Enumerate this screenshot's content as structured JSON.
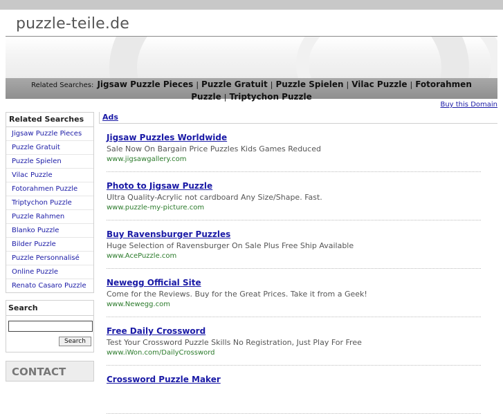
{
  "site": {
    "domain_title": "puzzle-teile.de",
    "buy_domain": "Buy this Domain"
  },
  "related_bar": {
    "label": "Related Searches:",
    "links": [
      "Jigsaw Puzzle Pieces",
      "Puzzle Gratuit",
      "Puzzle Spielen",
      "Vilac Puzzle",
      "Fotorahmen Puzzle",
      "Triptychon Puzzle"
    ],
    "separator": "|"
  },
  "sidebar": {
    "heading": "Related Searches",
    "items": [
      {
        "label": "Jigsaw Puzzle Pieces"
      },
      {
        "label": "Puzzle Gratuit"
      },
      {
        "label": "Puzzle Spielen"
      },
      {
        "label": "Vilac Puzzle"
      },
      {
        "label": "Fotorahmen Puzzle"
      },
      {
        "label": "Triptychon Puzzle"
      },
      {
        "label": "Puzzle Rahmen"
      },
      {
        "label": "Blanko Puzzle"
      },
      {
        "label": "Bilder Puzzle"
      },
      {
        "label": "Puzzle Personnalisé"
      },
      {
        "label": "Online Puzzle"
      },
      {
        "label": "Renato Casaro Puzzle"
      }
    ],
    "search": {
      "heading": "Search",
      "input_value": "",
      "button_label": "Search"
    },
    "contact": "CONTACT"
  },
  "main": {
    "ads_label": "Ads",
    "ads": [
      {
        "title": "Jigsaw Puzzles Worldwide",
        "desc": "Sale Now On Bargain Price Puzzles Kids Games Reduced",
        "url": "www.jigsawgallery.com"
      },
      {
        "title": "Photo to Jigsaw Puzzle",
        "desc": "Ultra Quality-Acrylic not cardboard Any Size/Shape. Fast.",
        "url": "www.puzzle-my-picture.com"
      },
      {
        "title": "Buy Ravensburger Puzzles",
        "desc": "Huge Selection of Ravensburger On Sale Plus Free Ship Available",
        "url": "www.AcePuzzle.com"
      },
      {
        "title": "Newegg Official Site",
        "desc": "Come for the Reviews. Buy for the Great Prices. Take it from a Geek!",
        "url": "www.Newegg.com"
      },
      {
        "title": "Free Daily Crossword",
        "desc": "Test Your Crossword Puzzle Skills No Registration, Just Play For Free",
        "url": "www.iWon.com/DailyCrossword"
      },
      {
        "title": "Crossword Puzzle Maker",
        "desc": "",
        "url": ""
      }
    ]
  },
  "colors": {
    "link": "#1a1aa6",
    "url_green": "#2a7a2a",
    "bar_gray": "#999999"
  }
}
